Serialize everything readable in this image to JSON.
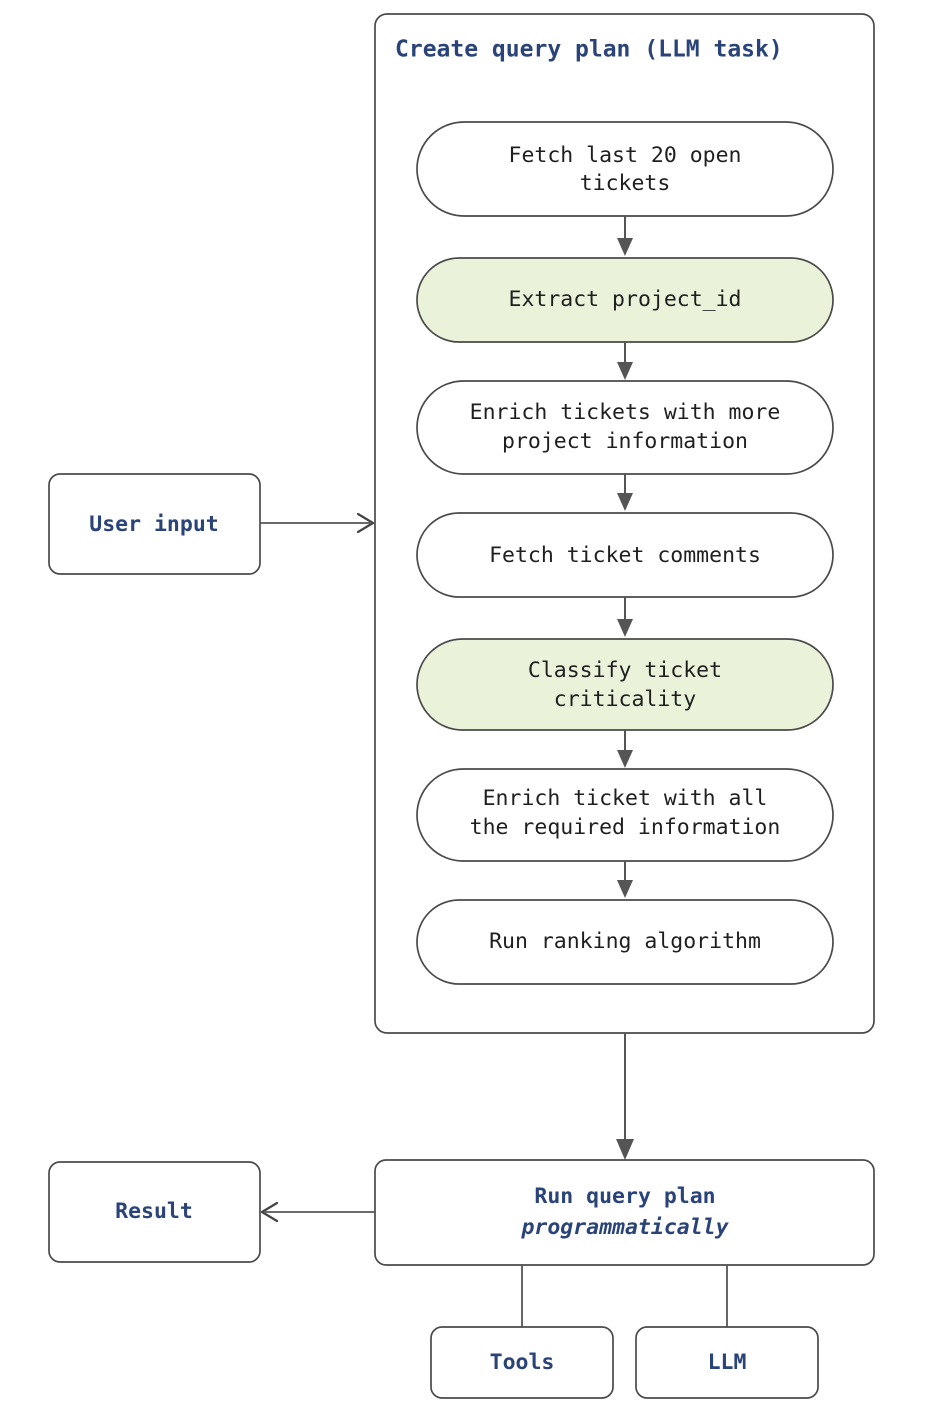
{
  "diagram": {
    "type": "flowchart",
    "direction": "top-down",
    "background": "#ffffff",
    "colors": {
      "accent_blue": "#2a4378",
      "node_text": "#1f1f1f",
      "node_border": "#4a4a4a",
      "node_fill": "#ffffff",
      "highlight_fill": "#eaf3da",
      "edge": "#555555"
    },
    "subgraph": {
      "title": "Create query plan (LLM task)",
      "steps": [
        {
          "id": "step-1",
          "label_line1": "Fetch last 20 open",
          "label_line2": "tickets",
          "highlight": false
        },
        {
          "id": "step-2",
          "label_line1": "Extract project_id",
          "label_line2": "",
          "highlight": true
        },
        {
          "id": "step-3",
          "label_line1": "Enrich tickets with more",
          "label_line2": "project information",
          "highlight": false
        },
        {
          "id": "step-4",
          "label_line1": "Fetch ticket comments",
          "label_line2": "",
          "highlight": false
        },
        {
          "id": "step-5",
          "label_line1": "Classify ticket",
          "label_line2": "criticality",
          "highlight": true
        },
        {
          "id": "step-6",
          "label_line1": "Enrich ticket with all",
          "label_line2": "the required information",
          "highlight": false
        },
        {
          "id": "step-7",
          "label_line1": "Run ranking algorithm",
          "label_line2": "",
          "highlight": false
        }
      ]
    },
    "nodes": {
      "user_input": {
        "label": "User input"
      },
      "result": {
        "label": "Result"
      },
      "run_query_plan": {
        "label_line1": "Run query plan",
        "label_line2": "programmatically"
      },
      "tools": {
        "label": "Tools"
      },
      "llm": {
        "label": "LLM"
      }
    }
  }
}
